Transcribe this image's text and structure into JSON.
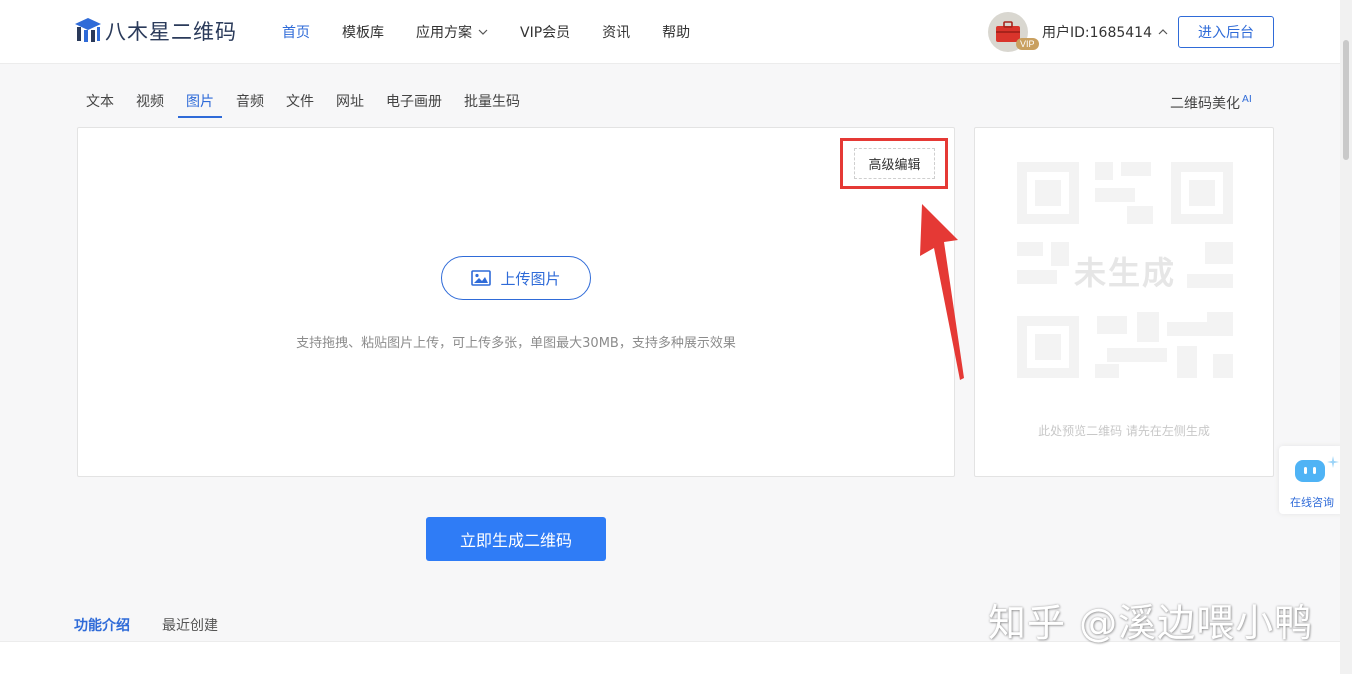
{
  "header": {
    "logo_text": "八木星二维码",
    "nav": [
      {
        "label": "首页",
        "active": true
      },
      {
        "label": "模板库",
        "active": false
      },
      {
        "label": "应用方案",
        "active": false,
        "has_dropdown": true
      },
      {
        "label": "VIP会员",
        "active": false
      },
      {
        "label": "资讯",
        "active": false
      },
      {
        "label": "帮助",
        "active": false
      }
    ],
    "user_label": "用户ID:1685414",
    "vip_badge": "VIP",
    "enter_button": "进入后台"
  },
  "tabs": [
    "文本",
    "视频",
    "图片",
    "音频",
    "文件",
    "网址",
    "电子画册",
    "批量生码"
  ],
  "active_tab": "图片",
  "beautify": {
    "label": "二维码美化",
    "badge": "AI"
  },
  "editor": {
    "advanced_edit": "高级编辑",
    "upload_button": "上传图片",
    "upload_hint": "支持拖拽、粘贴图片上传，可上传多张，单图最大30MB，支持多种展示效果"
  },
  "preview": {
    "status": "未生成",
    "hint": "此处预览二维码 请先在左侧生成"
  },
  "generate_button": "立即生成二维码",
  "bottom_tabs": [
    {
      "label": "功能介绍",
      "active": true
    },
    {
      "label": "最近创建",
      "active": false
    }
  ],
  "chat_widget": {
    "label": "在线咨询"
  },
  "watermark": "知乎 @溪边喂小鸭",
  "colors": {
    "accent": "#2f6bd8",
    "primary_button": "#2f7cf6",
    "highlight": "#e53935"
  }
}
